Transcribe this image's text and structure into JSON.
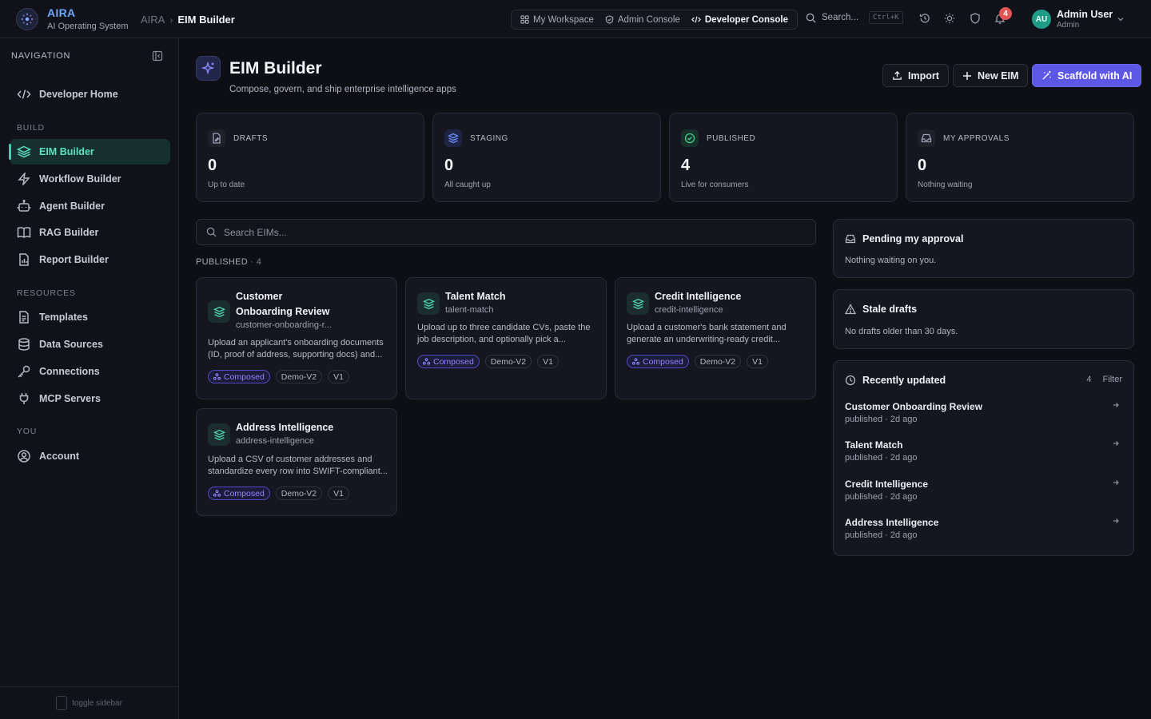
{
  "app": {
    "brand_name": "AIRA",
    "brand_sub": "AI Operating System",
    "breadcrumb_root": "AIRA",
    "breadcrumb_sep": "›",
    "breadcrumb_current": "EIM Builder"
  },
  "switcher": [
    {
      "label": "My Workspace",
      "icon": "grid-icon"
    },
    {
      "label": "Admin Console",
      "icon": "shield-icon"
    },
    {
      "label": "Developer Console",
      "icon": "code-icon"
    }
  ],
  "topbar": {
    "search_label": "Search...",
    "search_shortcut": "Ctrl+K",
    "notifications": "4",
    "user_initials": "AU",
    "user_name": "Admin User",
    "user_role": "Admin"
  },
  "sidebar": {
    "heading": "NAVIGATION",
    "sections": {
      "build": "BUILD",
      "resources": "RESOURCES",
      "you": "YOU"
    },
    "items": [
      {
        "label": "Developer Home",
        "icon": "code-icon"
      },
      {
        "label": "EIM Builder",
        "icon": "layers-icon"
      },
      {
        "label": "Workflow Builder",
        "icon": "bolt-icon"
      },
      {
        "label": "Agent Builder",
        "icon": "bot-icon"
      },
      {
        "label": "RAG Builder",
        "icon": "book-icon"
      },
      {
        "label": "Report Builder",
        "icon": "report-icon"
      },
      {
        "label": "Templates",
        "icon": "file-icon"
      },
      {
        "label": "Data Sources",
        "icon": "database-icon"
      },
      {
        "label": "Connections",
        "icon": "key-icon"
      },
      {
        "label": "MCP Servers",
        "icon": "plug-icon"
      },
      {
        "label": "Account",
        "icon": "user-circle-icon"
      }
    ],
    "footer": "toggle sidebar"
  },
  "page": {
    "title": "EIM Builder",
    "subtitle": "Compose, govern, and ship enterprise intelligence apps",
    "buttons": {
      "import": "Import",
      "new": "New EIM",
      "scaffold": "Scaffold with AI"
    }
  },
  "stats": [
    {
      "label": "DRAFTS",
      "value": "0",
      "note": "Up to date",
      "color": "#9aa0b4"
    },
    {
      "label": "STAGING",
      "value": "0",
      "note": "All caught up",
      "color": "#6e8cff"
    },
    {
      "label": "PUBLISHED",
      "value": "4",
      "note": "Live for consumers",
      "color": "#3fcf8e"
    },
    {
      "label": "MY APPROVALS",
      "value": "0",
      "note": "Nothing waiting",
      "color": "#9aa0b4"
    }
  ],
  "search": {
    "placeholder": "Search EIMs..."
  },
  "published": {
    "label": "PUBLISHED",
    "count": "· 4"
  },
  "cards": [
    {
      "title_lines": [
        "Customer",
        "Onboarding Review"
      ],
      "slug": "customer-onboarding-r...",
      "desc_lines": [
        "Upload an applicant's onboarding documents",
        "(ID, proof of address, supporting docs) and..."
      ],
      "tags": [
        "Composed",
        "Demo-V2",
        "V1"
      ]
    },
    {
      "title_lines": [
        "Talent Match"
      ],
      "slug": "talent-match",
      "desc_lines": [
        "Upload up to three candidate CVs, paste the",
        "job description, and optionally pick a..."
      ],
      "tags": [
        "Composed",
        "Demo-V2",
        "V1"
      ]
    },
    {
      "title_lines": [
        "Credit Intelligence"
      ],
      "slug": "credit-intelligence",
      "desc_lines": [
        "Upload a customer's bank statement and",
        "generate an underwriting-ready credit..."
      ],
      "tags": [
        "Composed",
        "Demo-V2",
        "V1"
      ]
    },
    {
      "title_lines": [
        "Address Intelligence"
      ],
      "slug": "address-intelligence",
      "desc_lines": [
        "Upload a CSV of customer addresses and",
        "standardize every row into SWIFT-compliant..."
      ],
      "tags": [
        "Composed",
        "Demo-V2",
        "V1"
      ]
    }
  ],
  "panels": {
    "pending": {
      "title": "Pending my approval",
      "body": "Nothing waiting on you."
    },
    "stale": {
      "title": "Stale drafts",
      "body": "No drafts older than 30 days."
    },
    "recent": {
      "title": "Recently updated",
      "count": "4",
      "filter": "Filter",
      "items": [
        {
          "name": "Customer Onboarding Review",
          "meta": "published · 2d ago"
        },
        {
          "name": "Talent Match",
          "meta": "published · 2d ago"
        },
        {
          "name": "Credit Intelligence",
          "meta": "published · 2d ago"
        },
        {
          "name": "Address Intelligence",
          "meta": "published · 2d ago"
        }
      ]
    }
  },
  "colors": {
    "accent": "#5d57e6",
    "active_nav": "#3fd1b0",
    "badge": "#e25555"
  }
}
